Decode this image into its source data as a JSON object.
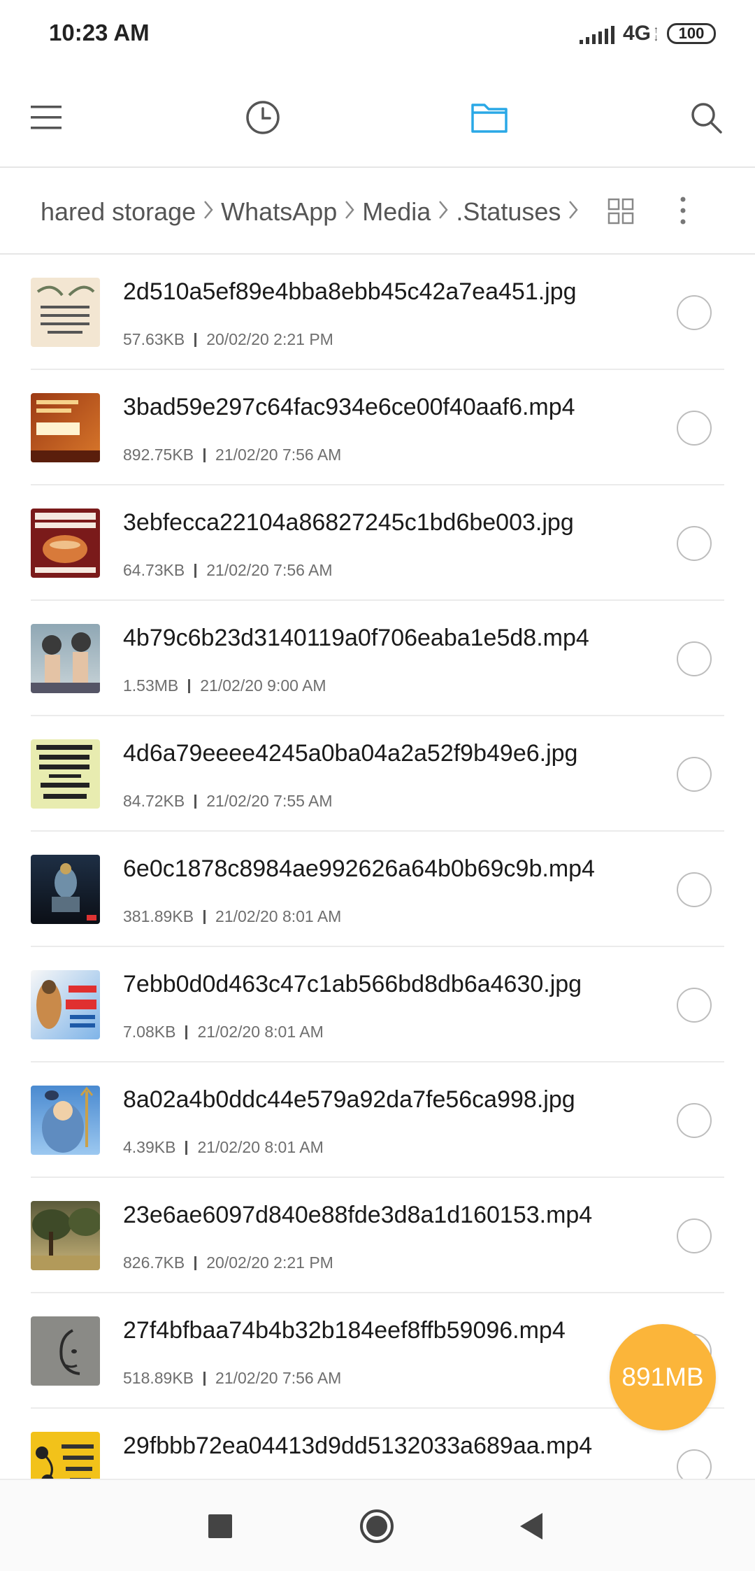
{
  "status_bar": {
    "time": "10:23 AM",
    "network": "4G",
    "battery": "100"
  },
  "toolbar": {
    "icons": [
      "menu-icon",
      "clock-icon",
      "folder-icon",
      "search-icon"
    ],
    "active_color": "#2aa8e6",
    "icon_color": "#555555"
  },
  "breadcrumb": {
    "items": [
      "Shared storage",
      "WhatsApp",
      "Media",
      ".Statuses"
    ]
  },
  "files": [
    {
      "name": "2d510a5ef89e4bba8ebb45c42a7ea451.jpg",
      "size": "57.63KB",
      "date": "20/02/20 2:21 PM"
    },
    {
      "name": "3bad59e297c64fac934e6ce00f40aaf6.mp4",
      "size": "892.75KB",
      "date": "21/02/20 7:56 AM"
    },
    {
      "name": "3ebfecca22104a86827245c1bd6be003.jpg",
      "size": "64.73KB",
      "date": "21/02/20 7:56 AM"
    },
    {
      "name": "4b79c6b23d3140119a0f706eaba1e5d8.mp4",
      "size": "1.53MB",
      "date": "21/02/20 9:00 AM"
    },
    {
      "name": "4d6a79eeee4245a0ba04a2a52f9b49e6.jpg",
      "size": "84.72KB",
      "date": "21/02/20 7:55 AM"
    },
    {
      "name": "6e0c1878c8984ae992626a64b0b69c9b.mp4",
      "size": "381.89KB",
      "date": "21/02/20 8:01 AM"
    },
    {
      "name": "7ebb0d0d463c47c1ab566bd8db6a4630.jpg",
      "size": "7.08KB",
      "date": "21/02/20 8:01 AM"
    },
    {
      "name": "8a02a4b0ddc44e579a92da7fe56ca998.jpg",
      "size": "4.39KB",
      "date": "21/02/20 8:01 AM"
    },
    {
      "name": "23e6ae6097d840e88fde3d8a1d160153.mp4",
      "size": "826.7KB",
      "date": "20/02/20 2:21 PM"
    },
    {
      "name": "27f4bfbaa74b4b32b184eef8ffb59096.mp4",
      "size": "518.89KB",
      "date": "21/02/20 7:56 AM"
    },
    {
      "name": "29fbbb72ea04413d9dd5132033a689aa.mp4",
      "size": "",
      "date": ""
    }
  ],
  "fab": {
    "label": "891MB",
    "color": "#fbb53a"
  },
  "nav_bar": {
    "icons": [
      "recents-square-icon",
      "home-circle-icon",
      "back-triangle-icon"
    ]
  }
}
